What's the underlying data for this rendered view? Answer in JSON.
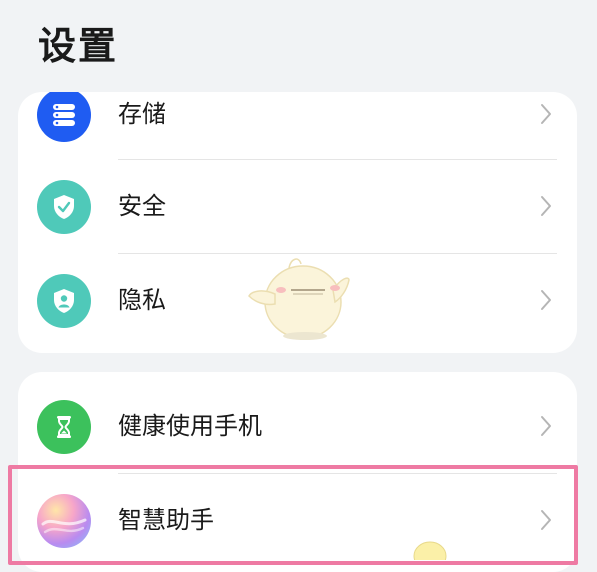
{
  "header": {
    "title": "设置"
  },
  "groups": [
    {
      "items": [
        {
          "label": "存储",
          "icon": "storage-icon",
          "icon_color": "#1f5cf2"
        },
        {
          "label": "安全",
          "icon": "security-shield-icon",
          "icon_color": "#4fc9b9"
        },
        {
          "label": "隐私",
          "icon": "privacy-shield-icon",
          "icon_color": "#4fc9b9"
        }
      ]
    },
    {
      "items": [
        {
          "label": "健康使用手机",
          "icon": "hourglass-icon",
          "icon_color": "#3cc15c"
        },
        {
          "label": "智慧助手",
          "icon": "smart-assistant-icon",
          "icon_color": "#b98bf0"
        }
      ]
    }
  ],
  "highlight": {
    "color": "#ee7aa3",
    "target": "智慧助手"
  }
}
